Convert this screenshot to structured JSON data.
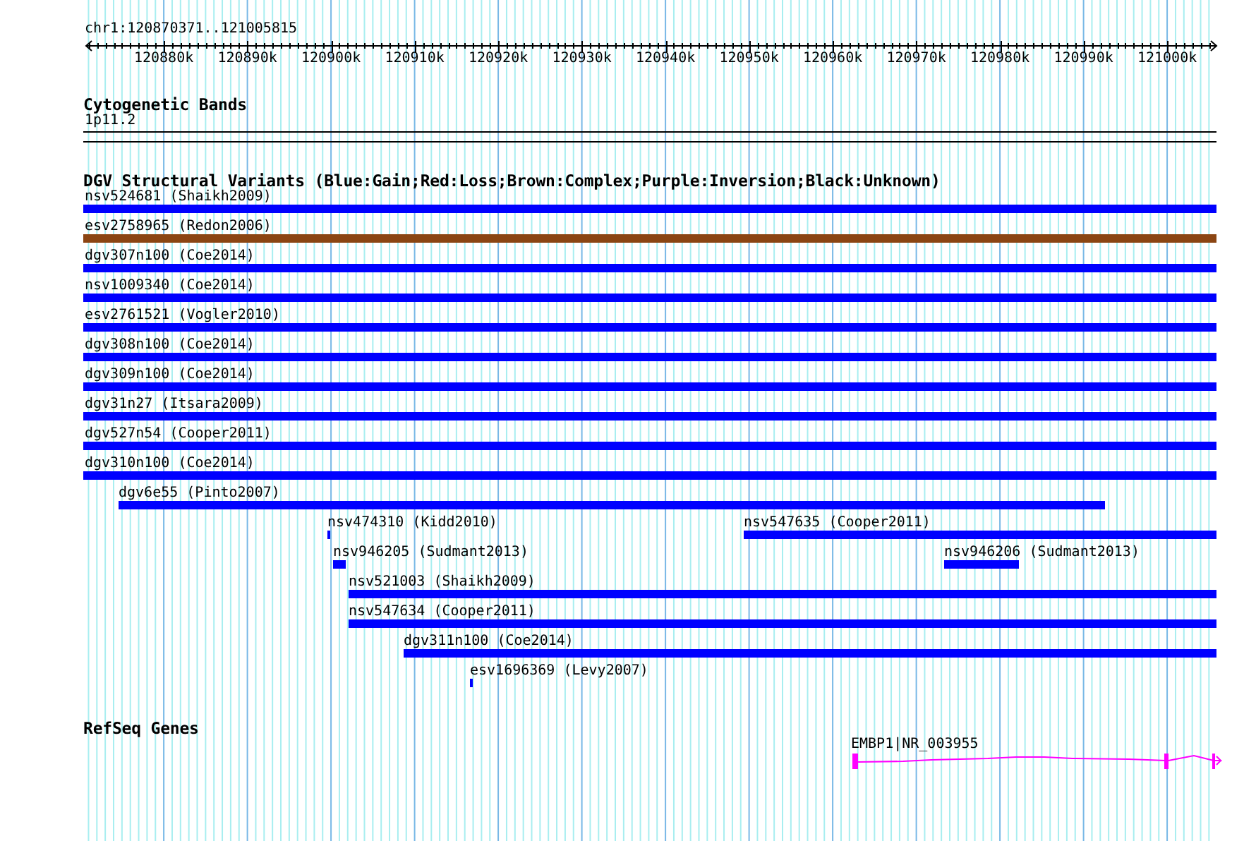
{
  "ruler": {
    "region": "chr1:120870371..121005815",
    "tick_labels": [
      "120880k",
      "120890k",
      "120900k",
      "120910k",
      "120920k",
      "120930k",
      "120940k",
      "120950k",
      "120960k",
      "120970k",
      "120980k",
      "120990k",
      "121000k"
    ]
  },
  "cytoband_track": {
    "title": "Cytogenetic Bands",
    "band": "1p11.2"
  },
  "dgv_track": {
    "title": "DGV Structural Variants (Blue:Gain;Red:Loss;Brown:Complex;Purple:Inversion;Black:Unknown)",
    "rows": [
      {
        "features": [
          {
            "label": "nsv524681 (Shaikh2009)",
            "color": "#0000ff"
          }
        ]
      },
      {
        "features": [
          {
            "label": "esv2758965 (Redon2006)",
            "color": "#8b4513"
          }
        ]
      },
      {
        "features": [
          {
            "label": "dgv307n100 (Coe2014)",
            "color": "#0000ff"
          }
        ]
      },
      {
        "features": [
          {
            "label": "nsv1009340 (Coe2014)",
            "color": "#0000ff"
          }
        ]
      },
      {
        "features": [
          {
            "label": "esv2761521 (Vogler2010)",
            "color": "#0000ff"
          }
        ]
      },
      {
        "features": [
          {
            "label": "dgv308n100 (Coe2014)",
            "color": "#0000ff"
          }
        ]
      },
      {
        "features": [
          {
            "label": "dgv309n100 (Coe2014)",
            "color": "#0000ff"
          }
        ]
      },
      {
        "features": [
          {
            "label": "dgv31n27 (Itsara2009)",
            "color": "#0000ff"
          }
        ]
      },
      {
        "features": [
          {
            "label": "dgv527n54 (Cooper2011)",
            "color": "#0000ff"
          }
        ]
      },
      {
        "features": [
          {
            "label": "dgv310n100 (Coe2014)",
            "color": "#0000ff"
          }
        ]
      },
      {
        "features": [
          {
            "label": "dgv6e55 (Pinto2007)",
            "color": "#0000ff"
          }
        ]
      },
      {
        "features": [
          {
            "label": "nsv474310 (Kidd2010)",
            "color": "#0000ff"
          },
          {
            "label": "nsv547635 (Cooper2011)",
            "color": "#0000ff"
          }
        ]
      },
      {
        "features": [
          {
            "label": "nsv946205 (Sudmant2013)",
            "color": "#0000ff"
          },
          {
            "label": "nsv946206 (Sudmant2013)",
            "color": "#0000ff"
          }
        ]
      },
      {
        "features": [
          {
            "label": "nsv521003 (Shaikh2009)",
            "color": "#0000ff"
          }
        ]
      },
      {
        "features": [
          {
            "label": "nsv547634 (Cooper2011)",
            "color": "#0000ff"
          }
        ]
      },
      {
        "features": [
          {
            "label": "dgv311n100 (Coe2014)",
            "color": "#0000ff"
          }
        ]
      },
      {
        "features": [
          {
            "label": "esv1696369 (Levy2007)",
            "color": "#0000ff"
          }
        ]
      }
    ]
  },
  "refseq_track": {
    "title": "RefSeq Genes",
    "genes": [
      {
        "label": "EMBP1|NR_003955"
      }
    ]
  }
}
